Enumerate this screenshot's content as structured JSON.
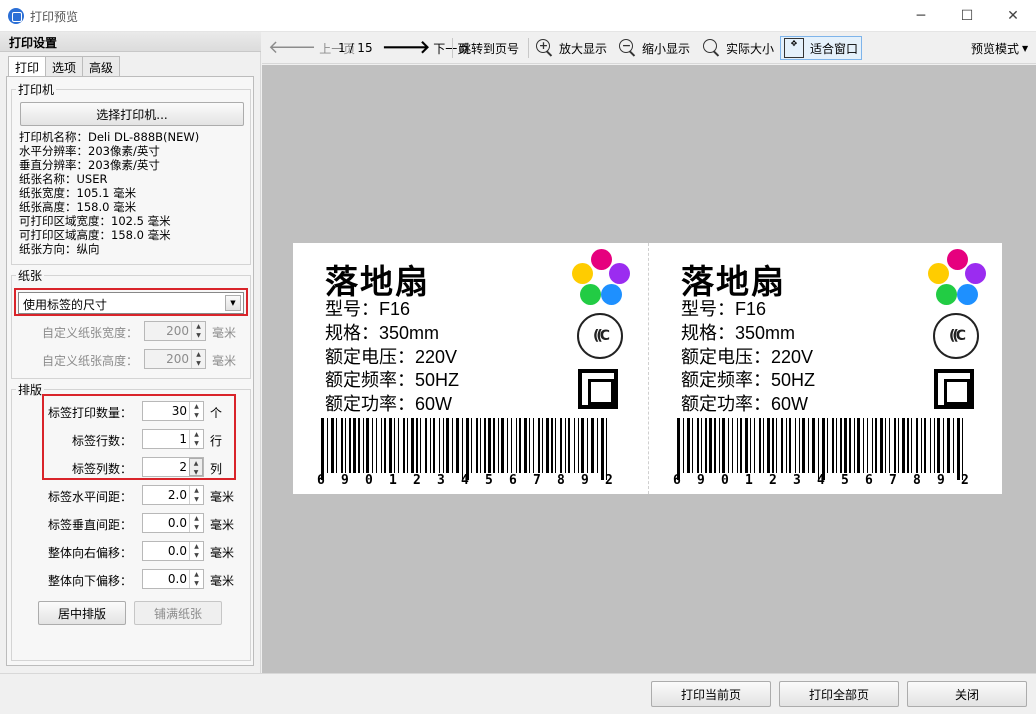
{
  "window": {
    "title": "打印预览",
    "min": "─",
    "max": "☐",
    "close": "✕"
  },
  "left_panel": {
    "header": "打印设置",
    "tabs": [
      "打印",
      "选项",
      "高级"
    ],
    "printer_group": {
      "title": "打印机",
      "select_button": "选择打印机...",
      "info": [
        "打印机名称：Deli DL-888B(NEW)",
        "水平分辨率：203像素/英寸",
        "垂直分辨率：203像素/英寸",
        "纸张名称：USER",
        "纸张宽度：105.1 毫米",
        "纸张高度：158.0 毫米",
        "可打印区域宽度：102.5 毫米",
        "可打印区域高度：158.0 毫米",
        "纸张方向：纵向"
      ]
    },
    "paper_group": {
      "title": "纸张",
      "size_option": "使用标签的尺寸",
      "width_label": "自定义纸张宽度：",
      "width_value": "200",
      "height_label": "自定义纸张高度：",
      "height_value": "200",
      "unit": "毫米"
    },
    "layout_group": {
      "title": "排版",
      "rows": [
        {
          "label": "标签打印数量：",
          "value": "30",
          "unit": "个"
        },
        {
          "label": "标签行数：",
          "value": "1",
          "unit": "行"
        },
        {
          "label": "标签列数：",
          "value": "2",
          "unit": "列"
        },
        {
          "label": "标签水平间距：",
          "value": "2.0",
          "unit": "毫米"
        },
        {
          "label": "标签垂直间距：",
          "value": "0.0",
          "unit": "毫米"
        },
        {
          "label": "整体向右偏移：",
          "value": "0.0",
          "unit": "毫米"
        },
        {
          "label": "整体向下偏移：",
          "value": "0.0",
          "unit": "毫米"
        }
      ],
      "center_button": "居中排版",
      "fill_button": "铺满纸张"
    }
  },
  "toolbar": {
    "prev": "上一页",
    "page_indicator": "1 / 15",
    "next": "下一页",
    "jump": "跳转到页号",
    "zoom_in": "放大显示",
    "zoom_out": "缩小显示",
    "actual_size": "实际大小",
    "fit_window": "适合窗口",
    "preview_mode": "预览模式"
  },
  "labels": [
    {
      "title": "落地扇",
      "lines": [
        "型号：F16",
        "规格：350mm",
        "额定电压：220V",
        "额定频率：50HZ",
        "额定功率：60W"
      ],
      "barcode_digits": [
        "6",
        "9",
        "0",
        "1",
        "2",
        "3",
        "4",
        "5",
        "6",
        "7",
        "8",
        "9",
        "2"
      ]
    },
    {
      "title": "落地扇",
      "lines": [
        "型号：F16",
        "规格：350mm",
        "额定电压：220V",
        "额定频率：50HZ",
        "额定功率：60W"
      ],
      "barcode_digits": [
        "6",
        "9",
        "0",
        "1",
        "2",
        "3",
        "4",
        "5",
        "6",
        "7",
        "8",
        "9",
        "2"
      ]
    }
  ],
  "colors": {
    "dot_colors": [
      "#e6007e",
      "#ffcc00",
      "#9b2cf0",
      "#22cc44",
      "#1e90ff"
    ],
    "highlight_red": "#d9242a"
  },
  "bottom": {
    "print_current": "打印当前页",
    "print_all": "打印全部页",
    "close": "关闭"
  }
}
